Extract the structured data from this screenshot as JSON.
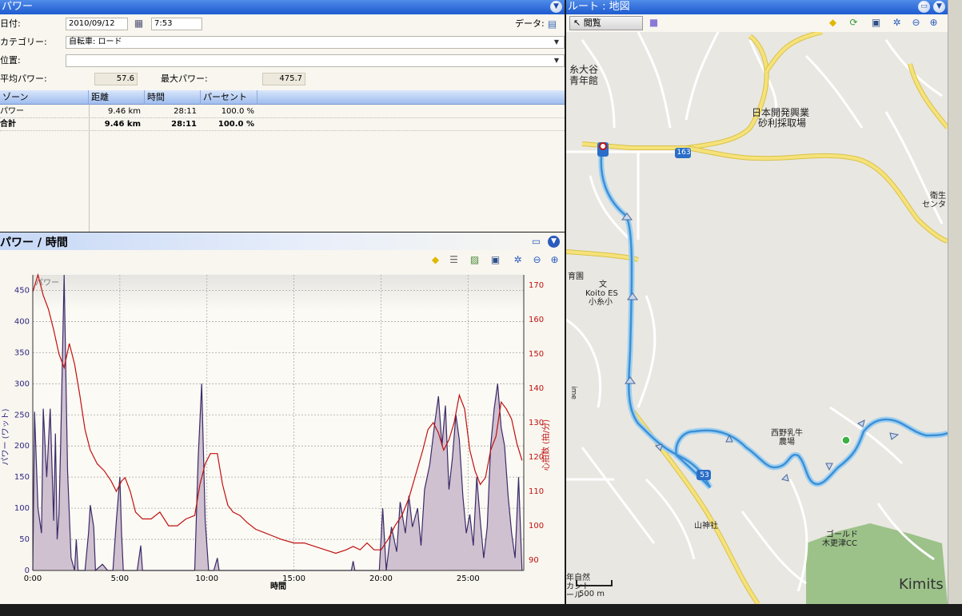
{
  "left_panel": {
    "title": "パワー",
    "date_label": "日付:",
    "date_value": "2010/09/12",
    "time_value": "7:53",
    "data_label": "データ:",
    "category_label": "カテゴリー:",
    "category_value": "自転車: ロード",
    "location_label": "位置:",
    "location_value": "",
    "avg_power_label": "平均パワー:",
    "avg_power_value": "57.6",
    "max_power_label": "最大パワー:",
    "max_power_value": "475.7",
    "table": {
      "headers": [
        "ゾーン",
        "距離",
        "時間",
        "パーセント"
      ],
      "rows": [
        {
          "zone": "パワー",
          "distance": "9.46 km",
          "time": "28:11",
          "percent": "100.0 %"
        },
        {
          "zone": "合計",
          "distance": "9.46 km",
          "time": "28:11",
          "percent": "100.0 %"
        }
      ]
    }
  },
  "chart_panel": {
    "title": "パワー / 時間"
  },
  "map_panel": {
    "title": "ルート : 地図",
    "browse_label": "閲覧",
    "labels": {
      "itoi": "糸大谷",
      "seinen": "青年館",
      "company1": "日本開発興業",
      "company2": "砂利採取場",
      "route163": "163",
      "eisei1": "衛生",
      "eisei2": "センタ",
      "ikuen": "育園",
      "school_sym": "文",
      "school1": "Koito ES",
      "school2": "小糸小",
      "farm1": "西野乳牛",
      "farm2": "農場",
      "shrine": "山神社",
      "golf1": "ゴールド",
      "golf2": "木更津CC",
      "route53": "53",
      "kimitsu": "Kimits",
      "scale": "500 m",
      "nature1": "年自然",
      "nature2": "カント",
      "nature3": "ール",
      "kome": "ime"
    }
  },
  "chart_data": {
    "type": "area",
    "title": "パワー",
    "xlabel": "時間",
    "ylabel": "パワー (ワット)",
    "y2label": "心拍数 (拍/分)",
    "xlim": [
      0,
      28.2
    ],
    "ylim": [
      0,
      475
    ],
    "y2lim": [
      87,
      173
    ],
    "x_ticks": [
      "0:00",
      "5:00",
      "10:00",
      "15:00",
      "20:00",
      "25:00"
    ],
    "y_ticks": [
      0,
      50,
      100,
      150,
      200,
      250,
      300,
      350,
      400,
      450
    ],
    "y2_ticks": [
      90,
      100,
      110,
      120,
      130,
      140,
      150,
      160,
      170
    ],
    "grid": true,
    "series": [
      {
        "name": "パワー",
        "color": "#3b2a6a",
        "fill": "#cfc1cf",
        "points": [
          [
            0,
            0
          ],
          [
            0.1,
            255
          ],
          [
            0.3,
            100
          ],
          [
            0.5,
            60
          ],
          [
            0.6,
            260
          ],
          [
            0.8,
            150
          ],
          [
            1.0,
            260
          ],
          [
            1.2,
            80
          ],
          [
            1.3,
            220
          ],
          [
            1.4,
            50
          ],
          [
            1.5,
            90
          ],
          [
            1.6,
            200
          ],
          [
            1.8,
            475
          ],
          [
            2.0,
            160
          ],
          [
            2.2,
            20
          ],
          [
            2.4,
            0
          ],
          [
            2.5,
            50
          ],
          [
            2.6,
            0
          ],
          [
            3.0,
            0
          ],
          [
            3.2,
            60
          ],
          [
            3.3,
            105
          ],
          [
            3.5,
            70
          ],
          [
            3.6,
            0
          ],
          [
            4.0,
            10
          ],
          [
            4.3,
            0
          ],
          [
            4.6,
            0
          ],
          [
            4.8,
            80
          ],
          [
            5.0,
            150
          ],
          [
            5.1,
            60
          ],
          [
            5.2,
            0
          ],
          [
            6.0,
            0
          ],
          [
            6.2,
            40
          ],
          [
            6.3,
            0
          ],
          [
            9.3,
            0
          ],
          [
            9.5,
            180
          ],
          [
            9.7,
            300
          ],
          [
            9.9,
            80
          ],
          [
            10.1,
            0
          ],
          [
            10.4,
            0
          ],
          [
            10.6,
            20
          ],
          [
            10.7,
            0
          ],
          [
            18.3,
            0
          ],
          [
            18.4,
            15
          ],
          [
            18.5,
            0
          ],
          [
            19.9,
            0
          ],
          [
            20.1,
            100
          ],
          [
            20.3,
            0
          ],
          [
            20.6,
            70
          ],
          [
            20.9,
            30
          ],
          [
            21.1,
            110
          ],
          [
            21.4,
            60
          ],
          [
            21.6,
            120
          ],
          [
            21.8,
            70
          ],
          [
            22.1,
            100
          ],
          [
            22.3,
            40
          ],
          [
            22.5,
            130
          ],
          [
            22.8,
            170
          ],
          [
            23.1,
            240
          ],
          [
            23.3,
            280
          ],
          [
            23.5,
            200
          ],
          [
            23.7,
            265
          ],
          [
            23.9,
            130
          ],
          [
            24.1,
            180
          ],
          [
            24.3,
            250
          ],
          [
            24.5,
            210
          ],
          [
            24.7,
            120
          ],
          [
            24.9,
            60
          ],
          [
            25.1,
            90
          ],
          [
            25.3,
            40
          ],
          [
            25.5,
            150
          ],
          [
            25.7,
            80
          ],
          [
            25.9,
            20
          ],
          [
            26.1,
            70
          ],
          [
            26.3,
            200
          ],
          [
            26.5,
            260
          ],
          [
            26.7,
            300
          ],
          [
            26.9,
            230
          ],
          [
            27.1,
            200
          ],
          [
            27.3,
            120
          ],
          [
            27.5,
            60
          ],
          [
            27.7,
            20
          ],
          [
            27.9,
            150
          ],
          [
            28.1,
            0
          ]
        ]
      },
      {
        "name": "心拍数",
        "color": "#c01010",
        "points": [
          [
            0,
            168
          ],
          [
            0.3,
            173
          ],
          [
            0.6,
            167
          ],
          [
            0.9,
            163
          ],
          [
            1.2,
            157
          ],
          [
            1.5,
            150
          ],
          [
            1.8,
            146
          ],
          [
            2.1,
            153
          ],
          [
            2.4,
            147
          ],
          [
            2.7,
            138
          ],
          [
            3.0,
            128
          ],
          [
            3.3,
            122
          ],
          [
            3.7,
            118
          ],
          [
            4.1,
            116
          ],
          [
            4.5,
            113
          ],
          [
            4.8,
            110
          ],
          [
            5.1,
            113
          ],
          [
            5.3,
            114
          ],
          [
            5.6,
            110
          ],
          [
            5.9,
            104
          ],
          [
            6.3,
            102
          ],
          [
            6.8,
            102
          ],
          [
            7.3,
            104
          ],
          [
            7.8,
            100
          ],
          [
            8.3,
            100
          ],
          [
            8.8,
            102
          ],
          [
            9.3,
            103
          ],
          [
            9.6,
            112
          ],
          [
            9.9,
            118
          ],
          [
            10.2,
            121
          ],
          [
            10.6,
            121
          ],
          [
            10.9,
            112
          ],
          [
            11.2,
            106
          ],
          [
            11.5,
            104
          ],
          [
            11.9,
            103
          ],
          [
            12.3,
            101
          ],
          [
            12.8,
            99
          ],
          [
            13.3,
            98
          ],
          [
            13.8,
            97
          ],
          [
            14.3,
            96
          ],
          [
            15.0,
            95
          ],
          [
            15.6,
            95
          ],
          [
            16.2,
            94
          ],
          [
            16.8,
            93
          ],
          [
            17.4,
            92
          ],
          [
            18.0,
            93
          ],
          [
            18.4,
            94
          ],
          [
            18.8,
            93
          ],
          [
            19.2,
            95
          ],
          [
            19.6,
            93
          ],
          [
            20.0,
            93
          ],
          [
            20.4,
            96
          ],
          [
            20.8,
            100
          ],
          [
            21.2,
            103
          ],
          [
            21.6,
            108
          ],
          [
            22.0,
            115
          ],
          [
            22.4,
            122
          ],
          [
            22.7,
            128
          ],
          [
            23.0,
            130
          ],
          [
            23.3,
            127
          ],
          [
            23.6,
            122
          ],
          [
            23.9,
            125
          ],
          [
            24.2,
            130
          ],
          [
            24.5,
            138
          ],
          [
            24.8,
            134
          ],
          [
            25.1,
            122
          ],
          [
            25.4,
            116
          ],
          [
            25.7,
            112
          ],
          [
            26.0,
            114
          ],
          [
            26.3,
            122
          ],
          [
            26.6,
            126
          ],
          [
            26.9,
            136
          ],
          [
            27.2,
            134
          ],
          [
            27.5,
            131
          ],
          [
            27.8,
            124
          ],
          [
            28.1,
            119
          ]
        ]
      }
    ]
  }
}
